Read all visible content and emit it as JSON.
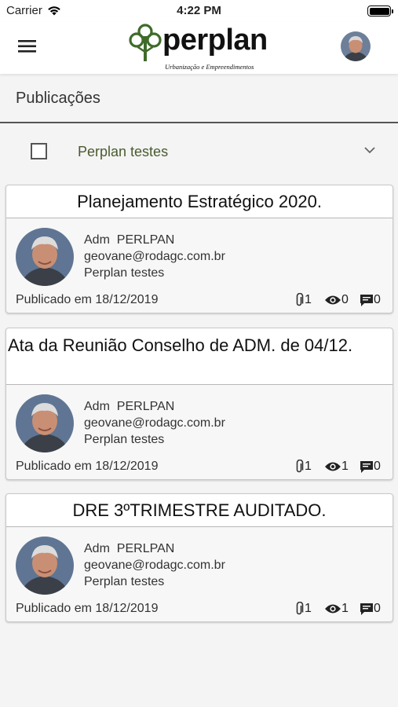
{
  "status_bar": {
    "carrier": "Carrier",
    "time": "4:22 PM",
    "icons": [
      "wifi-icon",
      "battery-icon"
    ]
  },
  "header": {
    "menu_icon": "hamburger-menu-icon",
    "logo_name": "perplan",
    "logo_tagline": "Urbanização e Empreendimentos",
    "avatar_icon": "user-avatar"
  },
  "page": {
    "title": "Publicações"
  },
  "filter": {
    "label": "Perplan testes",
    "checked": false,
    "chevron_icon": "chevron-down-icon"
  },
  "colors": {
    "logo_green": "#3f6b2a",
    "filter_text": "#4a5b2e",
    "background": "#f4f4f4"
  },
  "publications": [
    {
      "title": "Planejamento Estratégico 2020.",
      "author": "Adm  PERLPAN",
      "email": "geovane@rodagc.com.br",
      "group": "Perplan testes",
      "published": "Publicado em 18/12/2019",
      "attachments": "1",
      "views": "0",
      "comments": "0"
    },
    {
      "title": "Ata da Reunião Conselho de ADM. de 04/12.",
      "author": "Adm  PERLPAN",
      "email": "geovane@rodagc.com.br",
      "group": "Perplan testes",
      "published": "Publicado em 18/12/2019",
      "attachments": "1",
      "views": "1",
      "comments": "0"
    },
    {
      "title": "DRE 3ºTRIMESTRE AUDITADO.",
      "author": "Adm  PERLPAN",
      "email": "geovane@rodagc.com.br",
      "group": "Perplan testes",
      "published": "Publicado em 18/12/2019",
      "attachments": "1",
      "views": "1",
      "comments": "0"
    }
  ]
}
